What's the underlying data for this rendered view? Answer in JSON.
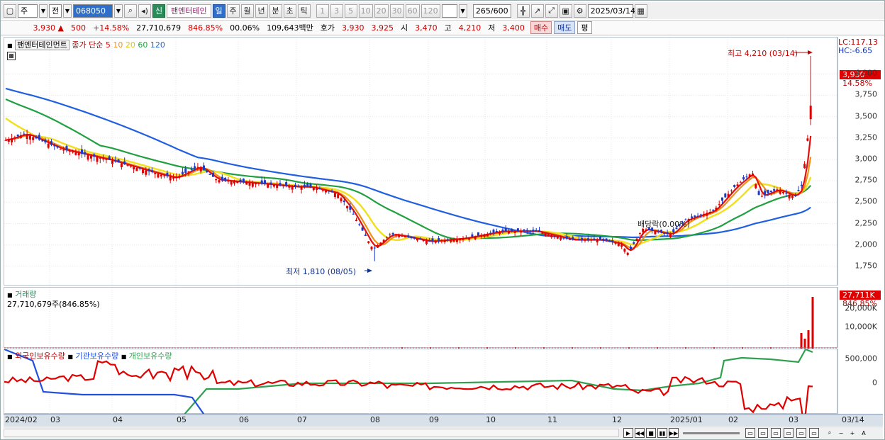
{
  "toolbar": {
    "mode": "주",
    "prefix": "전",
    "code": "068050",
    "badge": "신",
    "name": "팬엔터테인",
    "periods": [
      "일",
      "주",
      "월",
      "년",
      "분",
      "초",
      "틱"
    ],
    "minutes": [
      "1",
      "3",
      "5",
      "10",
      "20",
      "30",
      "60",
      "120"
    ],
    "count": "265",
    "count_total": "/600",
    "date": "2025/03/14"
  },
  "quote": {
    "price": "3,930",
    "arrow": "▲",
    "change": "500",
    "change_pct": "+14.58%",
    "volume": "27,710,679",
    "volume_pct": "846.85%",
    "rate": "00.06%",
    "amount": "109,643백만",
    "ask_label": "호가",
    "ask": "3,930",
    "bid": "3,925",
    "open_label": "시",
    "open": "3,470",
    "high_label": "고",
    "high": "4,210",
    "low_label": "저",
    "low": "3,400",
    "buy": "매수",
    "sell": "매도",
    "avg": "평"
  },
  "price_panel": {
    "name": "팬엔터테인먼트",
    "legend_prefix": "종가 단순",
    "ma_labels": [
      "5",
      "10",
      "20",
      "60",
      "120"
    ],
    "lc": "LC:117.13",
    "hc": "HC:-6.65",
    "high_note": "최고 4,210 (03/14)",
    "low_note": "최저 1,810 (08/05)",
    "dividend": "배당락(0.00%)",
    "price_tag": "3,930",
    "pct_tag": "14.58%",
    "yticks": [
      "4,000",
      "3,750",
      "3,500",
      "3,250",
      "3,000",
      "2,750",
      "2,500",
      "2,250",
      "2,000",
      "1,750"
    ]
  },
  "volume_panel": {
    "title": "거래량",
    "info": "27,710,679주(846.85%)",
    "tag": "27,711K",
    "tag_pct": "846.85%",
    "yticks": [
      "20,000K",
      "10,000K"
    ]
  },
  "holdings_panel": {
    "series": [
      "외국인보유수량",
      "기관보유수량",
      "개인보유수량"
    ],
    "yticks": [
      "500,000",
      "0"
    ]
  },
  "xaxis": {
    "labels": [
      "2024/02",
      "03",
      "04",
      "05",
      "06",
      "07",
      "08",
      "09",
      "10",
      "11",
      "12",
      "2025/01",
      "02",
      "03"
    ],
    "end_label": "03/14"
  },
  "colors": {
    "up": "#e00000",
    "down": "#1a3ac8",
    "ma5": "#e01010",
    "ma10": "#f09018",
    "ma20": "#f0e020",
    "ma60": "#20a040",
    "ma120": "#2060e0",
    "foreign": "#e00000",
    "inst": "#2050e0",
    "indiv": "#30a050"
  },
  "chart_data": {
    "type": "candlestick",
    "ylim": [
      1650,
      4300
    ],
    "months": [
      "2024/02",
      "03",
      "04",
      "05",
      "06",
      "07",
      "08",
      "09",
      "10",
      "11",
      "12",
      "2025/01",
      "02",
      "03"
    ],
    "close": [
      3300,
      3240,
      3150,
      3020,
      2880,
      2760,
      2720,
      2960,
      2830,
      2740,
      2710,
      2680,
      2600,
      2420,
      2100,
      2120,
      2060,
      2080,
      2130,
      2160,
      2180,
      2150,
      2160,
      2100,
      2050,
      2100,
      2080,
      2130,
      2400,
      2650,
      2620,
      3930
    ],
    "ma120_end": 2310,
    "ma60_end": 2510,
    "ma20_end": 2820,
    "ma10_end": 3000,
    "holdings": {
      "foreign_end": 0,
      "inst_end": -620000,
      "indiv_end": 420000
    }
  }
}
